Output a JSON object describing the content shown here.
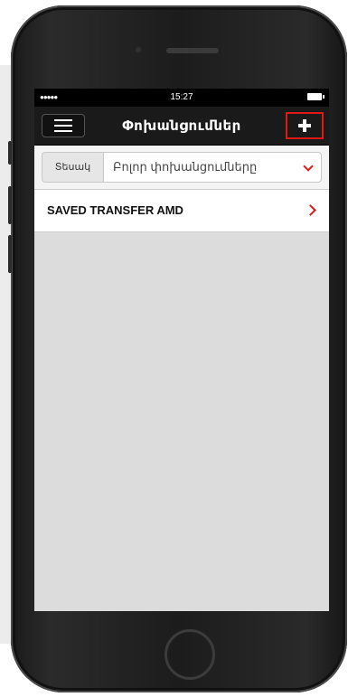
{
  "status_bar": {
    "signal": "●●●●●",
    "time": "15:27",
    "battery_icon": "battery-icon"
  },
  "nav": {
    "title": "Փոխանցումներ",
    "menu_icon": "hamburger-menu-icon",
    "add_icon": "plus-icon",
    "highlight_color": "#e01818"
  },
  "filter": {
    "label": "Տեսակ",
    "selected": "Բոլոր փոխանցումները",
    "dropdown_icon": "chevron-down-icon"
  },
  "transfers": [
    {
      "name": "SAVED TRANSFER AMD",
      "icon": "chevron-right-icon"
    }
  ],
  "colors": {
    "accent": "#e01818",
    "navbar": "#1a1a1a",
    "content_bg": "#dcdcdc"
  }
}
